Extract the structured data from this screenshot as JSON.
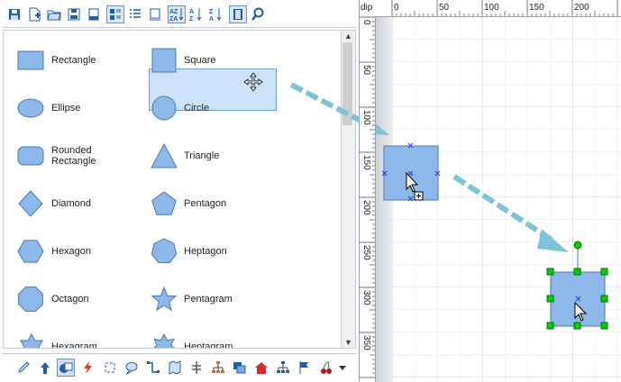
{
  "ruler": {
    "unit": "dip",
    "top_labels": [
      "0",
      "50",
      "100",
      "150",
      "200"
    ],
    "left_labels": [
      "0",
      "50",
      "100",
      "150",
      "200",
      "250",
      "300",
      "350"
    ]
  },
  "toolbar_icons": [
    "save-icon",
    "new-page-icon",
    "open-folder-icon",
    "save-as-icon",
    "print-icon",
    "icons-and-names-view-icon",
    "list-view-icon",
    "icons-only-view-icon",
    "sort-icon",
    "sort-ascending-icon",
    "sort-descending-icon",
    "book-icon",
    "search-icon"
  ],
  "shapes": [
    {
      "label": "Rectangle",
      "shape": "rect"
    },
    {
      "label": "Square",
      "shape": "square"
    },
    {
      "label": "Ellipse",
      "shape": "ellipse"
    },
    {
      "label": "Circle",
      "shape": "circle"
    },
    {
      "label": "Rounded\nRectangle",
      "shape": "roundrect"
    },
    {
      "label": "Triangle",
      "shape": "triangle"
    },
    {
      "label": "Diamond",
      "shape": "diamond"
    },
    {
      "label": "Pentagon",
      "shape": "pentagon"
    },
    {
      "label": "Hexagon",
      "shape": "hexagon"
    },
    {
      "label": "Heptagon",
      "shape": "heptagon"
    },
    {
      "label": "Octagon",
      "shape": "octagon"
    },
    {
      "label": "Pentagram",
      "shape": "pentagram"
    },
    {
      "label": "Hexagram",
      "shape": "hexagram"
    },
    {
      "label": "Heptagram",
      "shape": "heptagram"
    }
  ],
  "selected_shape": "Square",
  "bottom_icons": [
    "pencil-icon",
    "arrow-up-icon",
    "shapes-icon",
    "lightning-icon",
    "refresh-icon",
    "speech-bubble-icon",
    "connector-icon",
    "map-icon",
    "split-icon",
    "org-chart-icon",
    "layers-icon",
    "house-icon",
    "network-icon",
    "flags-icon",
    "cherries-icon",
    "more-dropdown-icon"
  ],
  "colors": {
    "shape_fill": "#8db8ea",
    "shape_stroke": "#4a78b0",
    "selection_handle": "#00d000",
    "drag_arrow": "#7ec4d8",
    "selected_item_bg": "#cde3fa"
  }
}
